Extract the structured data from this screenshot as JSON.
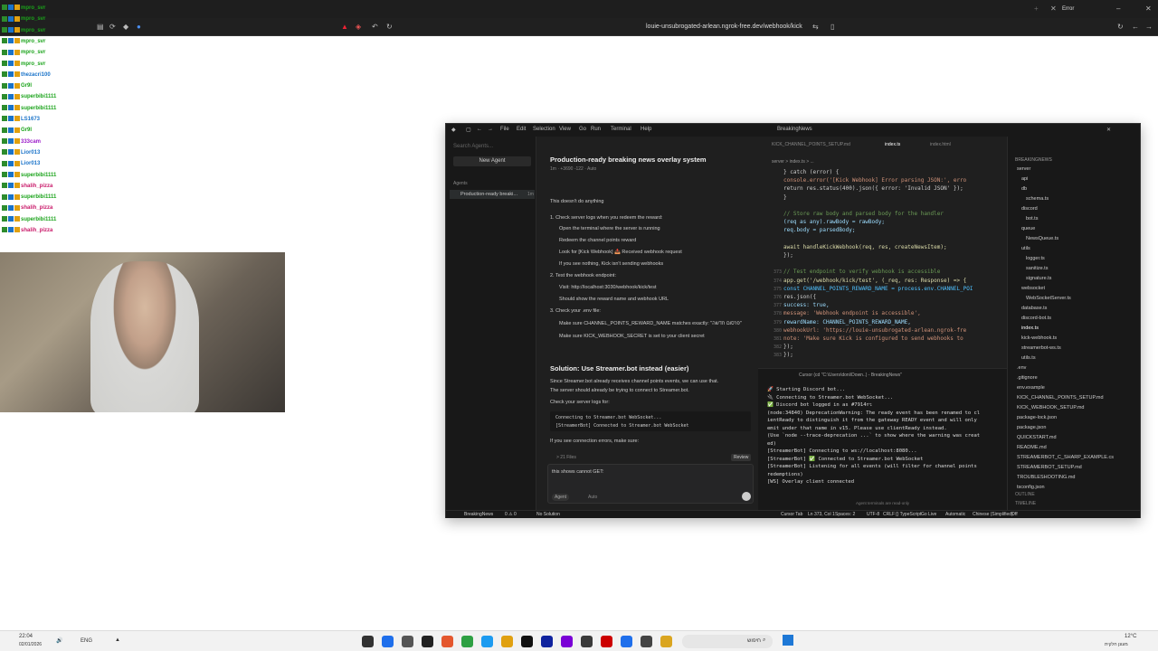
{
  "browser": {
    "tab_title": "Error",
    "url": "louie-unsubrogated-arlean.ngrok-free.dev/webhook/kick"
  },
  "chat": {
    "lines": [
      {
        "user": "mpro_svr",
        "msg": "",
        "color": "#1aa31a"
      },
      {
        "user": "mpro_svr",
        "msg": "",
        "color": "#1aa31a"
      },
      {
        "user": "mpro_svr",
        "msg": "",
        "color": "#1aa31a"
      },
      {
        "user": "mpro_svr",
        "msg": "",
        "color": "#1aa31a"
      },
      {
        "user": "mpro_svr",
        "msg": "",
        "color": "#1aa31a"
      },
      {
        "user": "mpro_svr",
        "msg": "",
        "color": "#1aa31a"
      },
      {
        "user": "thezacri100",
        "msg": "",
        "color": "#1a73c9"
      },
      {
        "user": "Gr9l",
        "msg": "",
        "color": "#1aa31a"
      },
      {
        "user": "superbibi1111",
        "msg": "",
        "color": "#1aa31a"
      },
      {
        "user": "superbibi1111",
        "msg": "",
        "color": "#1aa31a"
      },
      {
        "user": "LS1673",
        "msg": "",
        "color": "#1a73c9"
      },
      {
        "user": "Gr9l",
        "msg": "",
        "color": "#1aa31a"
      },
      {
        "user": "333cam",
        "msg": "",
        "color": "#9b1ac9"
      },
      {
        "user": "Lior013",
        "msg": "",
        "color": "#1a73c9"
      },
      {
        "user": "Lior013",
        "msg": "",
        "color": "#1a73c9"
      },
      {
        "user": "superbibi1111",
        "msg": "",
        "color": "#1aa31a"
      },
      {
        "user": "shalih_pizza",
        "msg": "",
        "color": "#c91a6a"
      },
      {
        "user": "superbibi1111",
        "msg": "",
        "color": "#1aa31a"
      },
      {
        "user": "shalih_pizza",
        "msg": "",
        "color": "#c91a6a"
      },
      {
        "user": "superbibi1111",
        "msg": "",
        "color": "#1aa31a"
      },
      {
        "user": "shalih_pizza",
        "msg": "",
        "color": "#c91a6a"
      }
    ]
  },
  "vscode": {
    "window_title": "BreakingNews",
    "menu": [
      "File",
      "Edit",
      "Selection",
      "View",
      "Go",
      "Run",
      "Terminal",
      "Help"
    ],
    "agents": {
      "search_placeholder": "Search Agents...",
      "new_agent": "New Agent",
      "section": "Agents",
      "item": "Production-ready breaki...",
      "item_time": "1m"
    },
    "chat": {
      "title": "Production-ready breaking news overlay system",
      "meta": "1m · +3690 -122 · Auto",
      "lines": [
        "This doesn't do anything",
        "1. Check server logs when you redeem the reward:",
        "Open the terminal where the server is running",
        "Redeem the channel points reward",
        "Look for [Kick Webhook] 📥 Received webhook request",
        "If you see nothing, Kick isn't sending webhooks",
        "2. Test the webhook endpoint:",
        "Visit: http://localhost:3030/webhook/kick/test",
        "Should show the reward name and webhook URL",
        "3. Check your .env file:",
        "Make sure CHANNEL_POINTS_REWARD_NAME matches exactly: \"פרסום חדשה\"",
        "Make sure KICK_WEBHOOK_SECRET is set to your client secret"
      ],
      "heading": "Solution: Use Streamer.bot instead (easier)",
      "para1": "Since Streamer.bot already receives channel points events, we can use that.",
      "para2": "The server should already be trying to connect to Streamer.bot.",
      "para3": "Check your server logs for:",
      "code1": "Connecting to Streamer.bot WebSocket...",
      "code2": "[StreamerBot] Connected to Streamer.bot WebSocket",
      "para4": "If you see connection errors, make sure:",
      "files_label": "> 21 Files",
      "review": "Review",
      "input_text": "this shows cannot GET:",
      "mode": "Agent",
      "model": "Auto"
    },
    "tabs": [
      "KICK_CHANNEL_POINTS_SETUP.md",
      "index.ts",
      "index.html"
    ],
    "breadcrumb": "server > index.ts > ...",
    "code": [
      {
        "n": "",
        "t": "} catch (error) {",
        "c": "#ccc"
      },
      {
        "n": "",
        "t": "  console.error('[Kick Webhook] Error parsing JSON:', erro",
        "c": "#ce9178"
      },
      {
        "n": "",
        "t": "  return res.status(400).json({ error: 'Invalid JSON' });",
        "c": "#ccc"
      },
      {
        "n": "",
        "t": "}",
        "c": "#ccc"
      },
      {
        "n": "",
        "t": "",
        "c": "#ccc"
      },
      {
        "n": "",
        "t": "// Store raw body and parsed body for the handler",
        "c": "#6a9955"
      },
      {
        "n": "",
        "t": "(req as any).rawBody = rawBody;",
        "c": "#9cdcfe"
      },
      {
        "n": "",
        "t": "req.body = parsedBody;",
        "c": "#9cdcfe"
      },
      {
        "n": "",
        "t": "",
        "c": "#ccc"
      },
      {
        "n": "",
        "t": "await handleKickWebhook(req, res, createNewsItem);",
        "c": "#dcdcaa"
      },
      {
        "n": "",
        "t": "});",
        "c": "#ccc"
      },
      {
        "n": "",
        "t": "",
        "c": "#ccc"
      },
      {
        "n": "373",
        "t": "// Test endpoint to verify webhook is accessible",
        "c": "#6a9955"
      },
      {
        "n": "374",
        "t": "app.get('/webhook/kick/test', (_req, res: Response) => {",
        "c": "#dcdcaa"
      },
      {
        "n": "375",
        "t": "  const CHANNEL_POINTS_REWARD_NAME = process.env.CHANNEL_POI",
        "c": "#4fc1ff"
      },
      {
        "n": "376",
        "t": "  res.json({",
        "c": "#ccc"
      },
      {
        "n": "377",
        "t": "    success: true,",
        "c": "#9cdcfe"
      },
      {
        "n": "378",
        "t": "    message: 'Webhook endpoint is accessible',",
        "c": "#ce9178"
      },
      {
        "n": "379",
        "t": "    rewardName: CHANNEL_POINTS_REWARD_NAME,",
        "c": "#9cdcfe"
      },
      {
        "n": "380",
        "t": "    webhookUrl: 'https://louie-unsubrogated-arlean.ngrok-fre",
        "c": "#ce9178"
      },
      {
        "n": "381",
        "t": "    note: 'Make sure Kick is configured to send webhooks to",
        "c": "#ce9178"
      },
      {
        "n": "382",
        "t": "  });",
        "c": "#ccc"
      },
      {
        "n": "383",
        "t": "});",
        "c": "#ccc"
      }
    ],
    "terminal_title": "Cursor (cd \"C:\\Users\\doni\\Down..) - BreakingNews\"",
    "terminal": [
      "🚀 Starting Discord bot...",
      "🔌 Connecting to Streamer.bot WebSocket...",
      "✅ Discord bot logged in as ניוז#7914",
      "(node:34840) DeprecationWarning: The ready event has been renamed to cl",
      "ientReady to distinguish it from the gateway READY event and will only",
      " emit under that name in v15. Please use clientReady instead.",
      "(Use `node --trace-deprecation ...` to show where the warning was creat",
      "ed)",
      "[StreamerBot] Connecting to ws://localhost:8080...",
      "[StreamerBot] ✅ Connected to Streamer.bot WebSocket",
      "[StreamerBot] Listening for all events (will filter for channel points",
      " redemptions)",
      "[WS] Overlay client connected"
    ],
    "terminal_footer": "Agent terminals are read-only",
    "explorer": {
      "header": "BREAKINGNEWS",
      "items": [
        {
          "name": "server",
          "indent": 0,
          "c": "#ccc"
        },
        {
          "name": "api",
          "indent": 1,
          "c": "#ccc"
        },
        {
          "name": "db",
          "indent": 1,
          "c": "#ccc"
        },
        {
          "name": "schema.ts",
          "indent": 2,
          "c": "#ccc"
        },
        {
          "name": "discord",
          "indent": 1,
          "c": "#ccc"
        },
        {
          "name": "bot.ts",
          "indent": 2,
          "c": "#ccc"
        },
        {
          "name": "queue",
          "indent": 1,
          "c": "#ccc"
        },
        {
          "name": "NewsQueue.ts",
          "indent": 2,
          "c": "#ccc"
        },
        {
          "name": "utils",
          "indent": 1,
          "c": "#ccc"
        },
        {
          "name": "logger.ts",
          "indent": 2,
          "c": "#ccc"
        },
        {
          "name": "sanitize.ts",
          "indent": 2,
          "c": "#ccc"
        },
        {
          "name": "signature.ts",
          "indent": 2,
          "c": "#ccc"
        },
        {
          "name": "websocket",
          "indent": 1,
          "c": "#ccc"
        },
        {
          "name": "WebSocketServer.ts",
          "indent": 2,
          "c": "#ccc"
        },
        {
          "name": "database.ts",
          "indent": 1,
          "c": "#ccc"
        },
        {
          "name": "discord-bot.ts",
          "indent": 1,
          "c": "#ccc"
        },
        {
          "name": "index.ts",
          "indent": 1,
          "c": "#fff"
        },
        {
          "name": "kick-webhook.ts",
          "indent": 1,
          "c": "#ccc"
        },
        {
          "name": "streamerbot-ws.ts",
          "indent": 1,
          "c": "#ccc"
        },
        {
          "name": "utils.ts",
          "indent": 1,
          "c": "#ccc"
        },
        {
          "name": ".env",
          "indent": 0,
          "c": "#ccc"
        },
        {
          "name": ".gitignore",
          "indent": 0,
          "c": "#ccc"
        },
        {
          "name": "env.example",
          "indent": 0,
          "c": "#ccc"
        },
        {
          "name": "KICK_CHANNEL_POINTS_SETUP.md",
          "indent": 0,
          "c": "#ccc"
        },
        {
          "name": "KICK_WEBHOOK_SETUP.md",
          "indent": 0,
          "c": "#ccc"
        },
        {
          "name": "package-lock.json",
          "indent": 0,
          "c": "#ccc"
        },
        {
          "name": "package.json",
          "indent": 0,
          "c": "#ccc"
        },
        {
          "name": "QUICKSTART.md",
          "indent": 0,
          "c": "#ccc"
        },
        {
          "name": "README.md",
          "indent": 0,
          "c": "#ccc"
        },
        {
          "name": "STREAMERBOT_C_SHARP_EXAMPLE.cs",
          "indent": 0,
          "c": "#ccc"
        },
        {
          "name": "STREAMERBOT_SETUP.md",
          "indent": 0,
          "c": "#ccc"
        },
        {
          "name": "TROUBLESHOOTING.md",
          "indent": 0,
          "c": "#ccc"
        },
        {
          "name": "tsconfig.json",
          "indent": 0,
          "c": "#ccc"
        }
      ],
      "outline": "OUTLINE",
      "timeline": "TIMELINE"
    },
    "status": {
      "left1": "BreakingNews",
      "left2": "0 ⚠ 0",
      "left3": "No Solution",
      "right": [
        "Cursor Tab",
        "Ln 373, Col 1",
        "Spaces: 2",
        "UTF-8",
        "CRLF",
        "{} TypeScript",
        "Go Live",
        "Automatic",
        "Chinese (Simplified)",
        "Off"
      ]
    }
  },
  "taskbar": {
    "time": "22:04",
    "date": "02/01/2026",
    "lang": "ENG",
    "search": "חיפוש",
    "weather_temp": "12°C",
    "weather_desc": "מעונן חלקית"
  }
}
